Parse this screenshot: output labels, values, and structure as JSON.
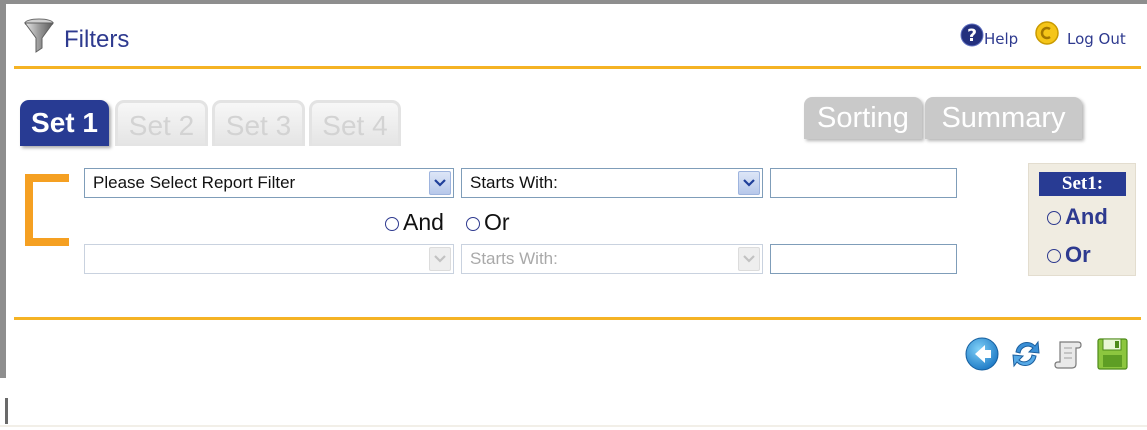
{
  "header": {
    "title": "Filters",
    "help_label": "Help",
    "logout_label": "Log Out"
  },
  "set_tabs": [
    {
      "label": "Set 1",
      "active": true
    },
    {
      "label": "Set 2",
      "active": false
    },
    {
      "label": "Set 3",
      "active": false
    },
    {
      "label": "Set 4",
      "active": false
    }
  ],
  "right_tabs": [
    {
      "label": "Sorting"
    },
    {
      "label": "Summary"
    }
  ],
  "filter_row_1": {
    "field_select": "Please Select Report Filter",
    "operator_select": "Starts With:",
    "value": ""
  },
  "connector": {
    "and_label": "And",
    "or_label": "Or"
  },
  "filter_row_2": {
    "field_select": "",
    "operator_select": "Starts With:",
    "value": ""
  },
  "set_connector": {
    "title": "Set1:",
    "and_label": "And",
    "or_label": "Or"
  },
  "toolbar_icons": [
    "back-icon",
    "refresh-icon",
    "script-icon",
    "save-icon"
  ],
  "colors": {
    "accent_orange": "#f5b324",
    "brand_blue": "#283b93",
    "link_blue": "#2e3a8f"
  }
}
